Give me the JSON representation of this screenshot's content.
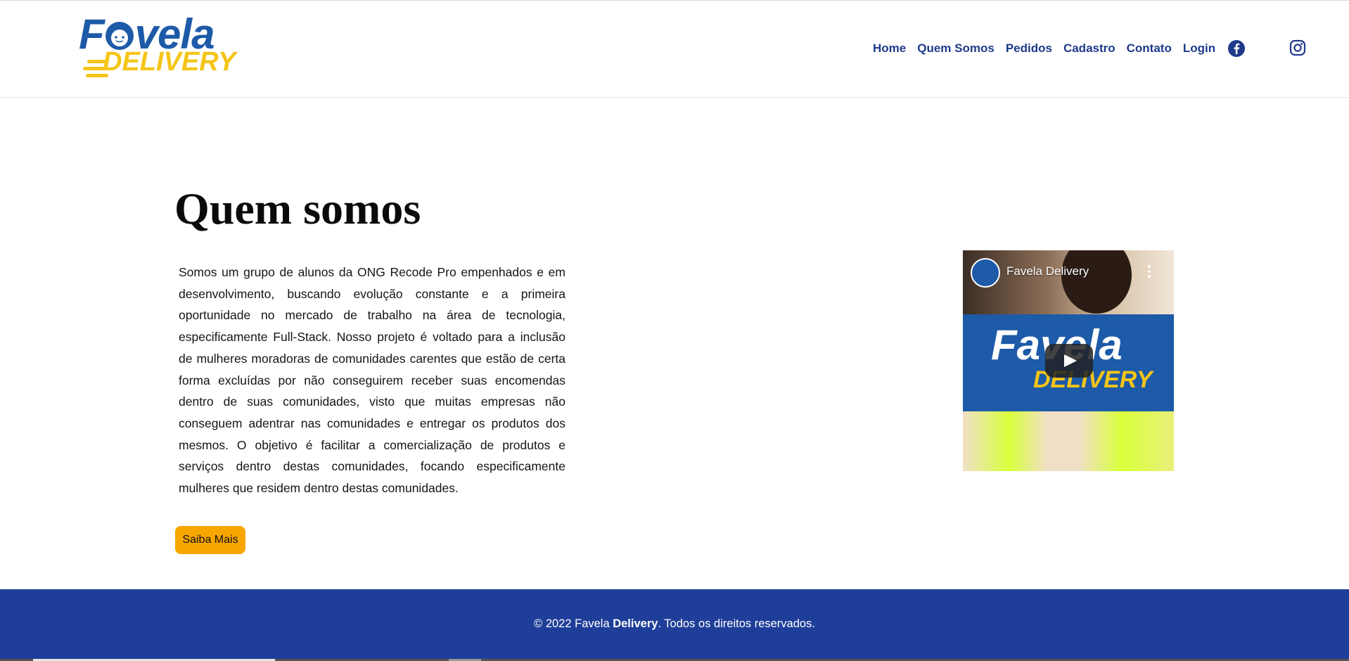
{
  "header": {
    "logo": {
      "word": "Favela",
      "sub": "DELIVERY",
      "primary_color": "#1d5aa8",
      "accent_color": "#f5c518"
    },
    "nav": [
      {
        "label": "Home"
      },
      {
        "label": "Quem Somos"
      },
      {
        "label": "Pedidos"
      },
      {
        "label": "Cadastro"
      },
      {
        "label": "Contato"
      },
      {
        "label": "Login"
      }
    ],
    "social": [
      {
        "icon": "facebook-icon"
      },
      {
        "icon": "instagram-icon"
      }
    ],
    "nav_color": "#1f3a8a"
  },
  "main": {
    "title": "Quem somos",
    "paragraph": "Somos um grupo de alunos da ONG Recode Pro empenhados e em desenvolvimento, buscando evolução constante e a primeira oportunidade no mercado de trabalho na área de tecnologia, especificamente Full-Stack. Nosso projeto é voltado para a inclusão de mulheres moradoras de comunidades carentes que estão de certa forma excluídas por não conseguirem receber suas encomendas dentro de suas comunidades, visto que muitas empresas não conseguem adentrar nas comunidades e entregar os produtos dos mesmos. O objetivo é facilitar a comercialização de produtos e serviços dentro destas comunidades, focando especificamente mulheres que residem dentro destas comunidades.",
    "button_label": "Saiba Mais",
    "button_color": "#f7a600"
  },
  "video": {
    "title": "Favela Delivery",
    "banner_word": "Favela",
    "banner_sub": "DELIVERY"
  },
  "footer": {
    "copyright_prefix": "© 2022 Favela ",
    "copyright_bold": "Delivery",
    "copyright_suffix": ". Todos os direitos reservados.",
    "background": "#1f3e99"
  }
}
